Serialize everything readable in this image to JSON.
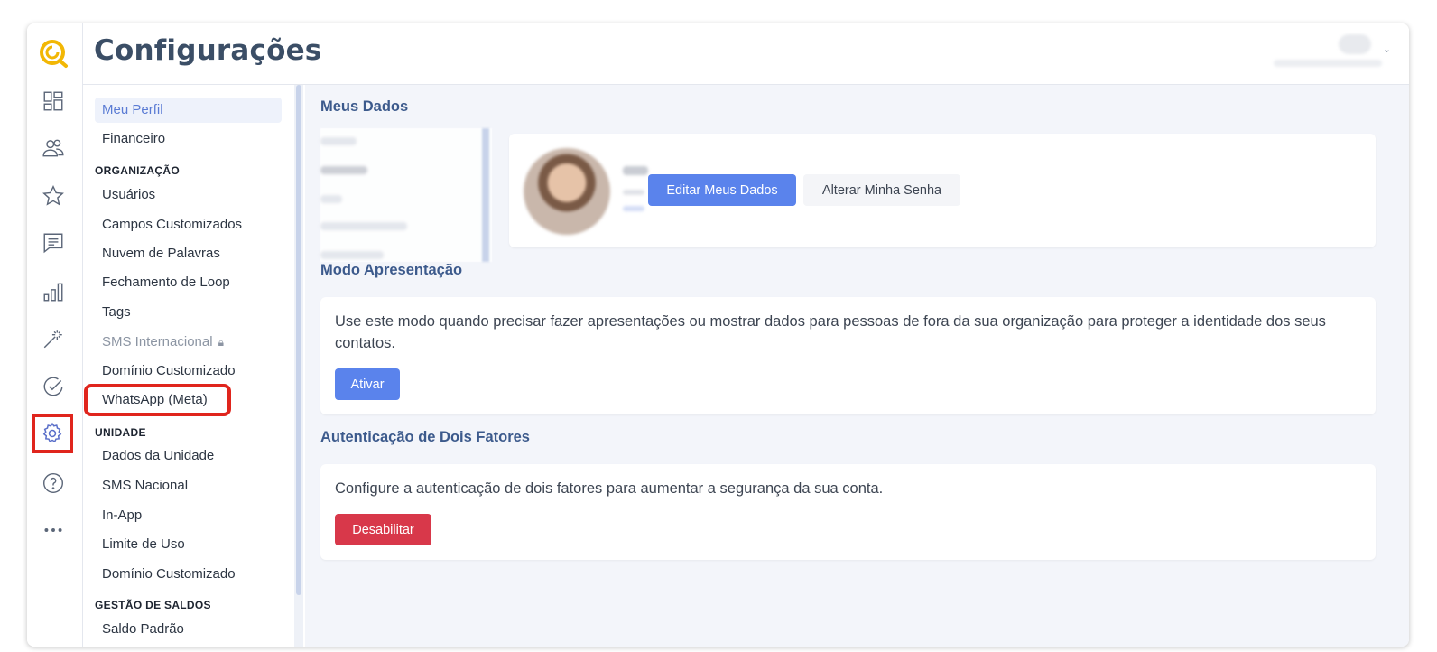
{
  "header": {
    "title": "Configurações"
  },
  "rail": {
    "icons": [
      "logo-icon",
      "dashboard-icon",
      "contacts-icon",
      "star-icon",
      "chat-icon",
      "chart-icon",
      "magic-wand-icon",
      "check-circle-icon",
      "gear-icon",
      "help-icon",
      "more-icon"
    ]
  },
  "settings_nav": {
    "items": [
      {
        "label": "Meu Perfil"
      },
      {
        "label": "Financeiro"
      }
    ],
    "sections": [
      {
        "label": "ORGANIZAÇÃO"
      },
      {
        "label": "UNIDADE"
      },
      {
        "label": "GESTÃO DE SALDOS"
      }
    ],
    "org_items": [
      {
        "label": "Usuários"
      },
      {
        "label": "Campos Customizados"
      },
      {
        "label": "Nuvem de Palavras"
      },
      {
        "label": "Fechamento de Loop"
      },
      {
        "label": "Tags"
      },
      {
        "label": "SMS Internacional"
      },
      {
        "label": "Domínio Customizado"
      },
      {
        "label": "WhatsApp (Meta)"
      }
    ],
    "unit_items": [
      {
        "label": "Dados da Unidade"
      },
      {
        "label": "SMS Nacional"
      },
      {
        "label": "In-App"
      },
      {
        "label": "Limite de Uso"
      },
      {
        "label": "Domínio Customizado"
      }
    ],
    "balance_items": [
      {
        "label": "Saldo Padrão"
      }
    ]
  },
  "main": {
    "meus_dados": {
      "title": "Meus Dados",
      "edit_button": "Editar Meus Dados",
      "password_button": "Alterar Minha Senha"
    },
    "modo_apresentacao": {
      "title": "Modo Apresentação",
      "text": "Use este modo quando precisar fazer apresentações ou mostrar dados para pessoas de fora da sua organização para proteger a identidade dos seus contatos.",
      "button": "Ativar"
    },
    "dois_fatores": {
      "title": "Autenticação de Dois Fatores",
      "text": "Configure a autenticação de dois fatores para aumentar a segurança da sua conta.",
      "button": "Desabilitar"
    }
  },
  "colors": {
    "accent": "#5a83ec",
    "danger": "#d8384a",
    "highlight_box": "#e0251d",
    "logo": "#f2b705"
  }
}
